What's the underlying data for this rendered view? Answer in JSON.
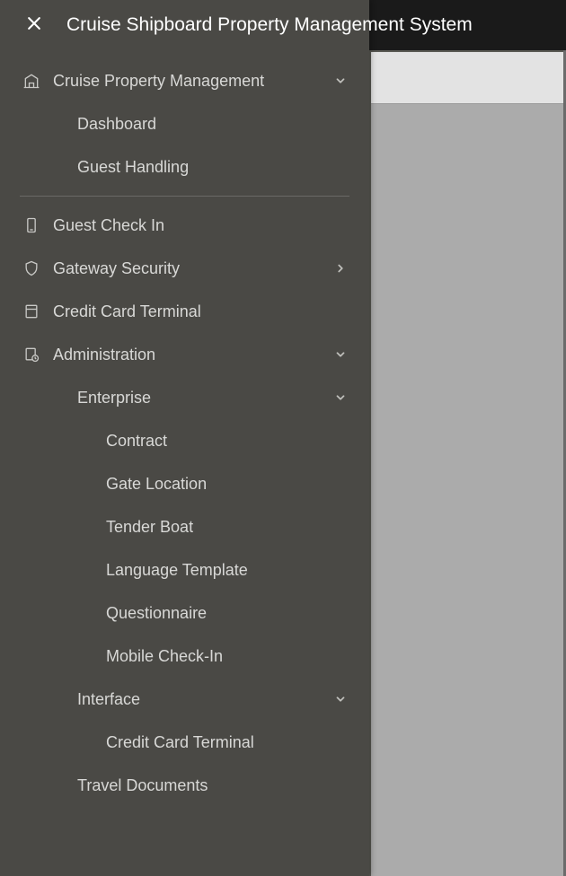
{
  "header": {
    "title": "Cruise Shipboard Property Management System"
  },
  "menu": {
    "cruise_property_mgmt": {
      "label": "Cruise Property Management",
      "dashboard": "Dashboard",
      "guest_handling": "Guest Handling"
    },
    "guest_check_in": "Guest Check In",
    "gateway_security": "Gateway Security",
    "credit_card_terminal": "Credit Card Terminal",
    "administration": {
      "label": "Administration",
      "enterprise": {
        "label": "Enterprise",
        "contract": "Contract",
        "gate_location": "Gate Location",
        "tender_boat": "Tender Boat",
        "language_template": "Language Template",
        "questionnaire": "Questionnaire",
        "mobile_check_in": "Mobile Check-In"
      },
      "interface": {
        "label": "Interface",
        "credit_card_terminal": "Credit Card Terminal"
      },
      "travel_documents": "Travel Documents"
    }
  }
}
